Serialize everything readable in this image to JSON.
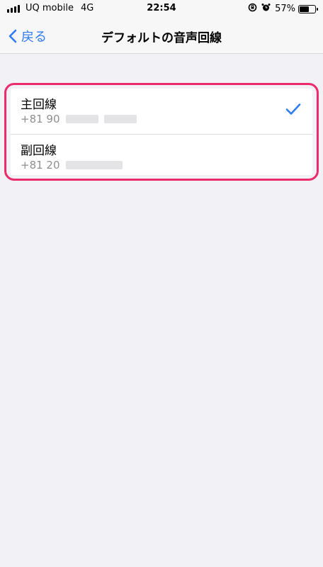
{
  "status_bar": {
    "carrier": "UQ mobile",
    "network": "4G",
    "time": "22:54",
    "battery": "57%"
  },
  "nav": {
    "back_label": "戻る",
    "title": "デフォルトの音声回線"
  },
  "lines": [
    {
      "title": "主回線",
      "number_prefix": "+81 90",
      "selected": true
    },
    {
      "title": "副回線",
      "number_prefix": "+81 20",
      "selected": false
    }
  ],
  "colors": {
    "accent": "#2f7bf3",
    "highlight": "#ec2c6a",
    "background": "#f2f1f6"
  }
}
